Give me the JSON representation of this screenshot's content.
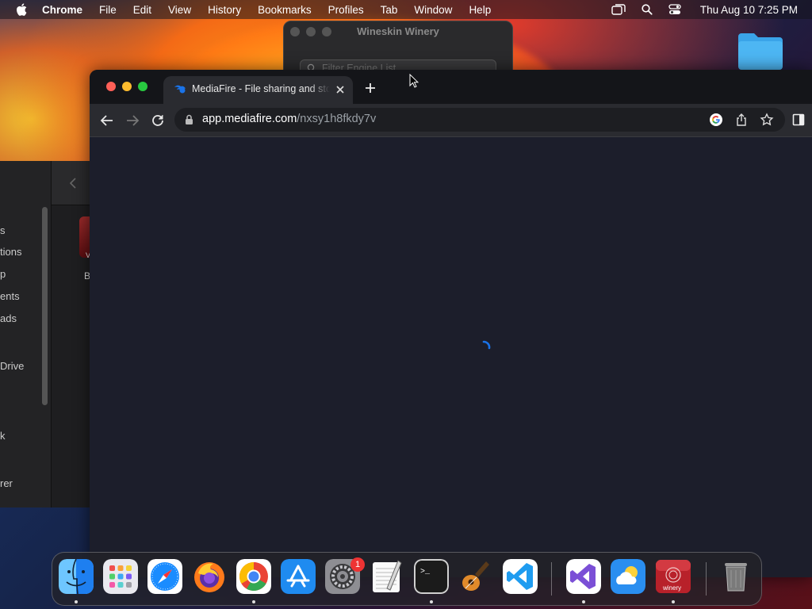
{
  "menubar": {
    "app_name": "Chrome",
    "menus": [
      "File",
      "Edit",
      "View",
      "History",
      "Bookmarks",
      "Profiles",
      "Tab",
      "Window",
      "Help"
    ],
    "clock": "Thu Aug 10  7:25 PM"
  },
  "finder": {
    "sidebar_fragments": [
      "s",
      "tions",
      "p",
      "ents",
      "ads",
      "Drive",
      "k",
      "rer"
    ],
    "file_label_fragment": "B",
    "file_icon_letter": "V"
  },
  "wineskin": {
    "title": "Wineskin Winery",
    "filter_placeholder": "Filter Engine List"
  },
  "chrome": {
    "tab_title": "MediaFire - File sharing and storage",
    "url_host": "app.mediafire.com",
    "url_path": "/nxsy1h8fkdy7v"
  },
  "dock": {
    "apps": [
      "Finder",
      "Launchpad",
      "Safari",
      "Firefox",
      "Google Chrome",
      "App Store",
      "System Settings",
      "TextEdit",
      "Terminal",
      "GarageBand",
      "Visual Studio Code",
      "Visual Studio",
      "Weather",
      "Wineskin Winery",
      "Trash"
    ],
    "settings_badge": "1",
    "winery_label": "winery"
  },
  "colors": {
    "accent_blue": "#1a73e8",
    "close_red": "#ff5f57",
    "minimize_yellow": "#febc2e",
    "zoom_green": "#28c840"
  }
}
